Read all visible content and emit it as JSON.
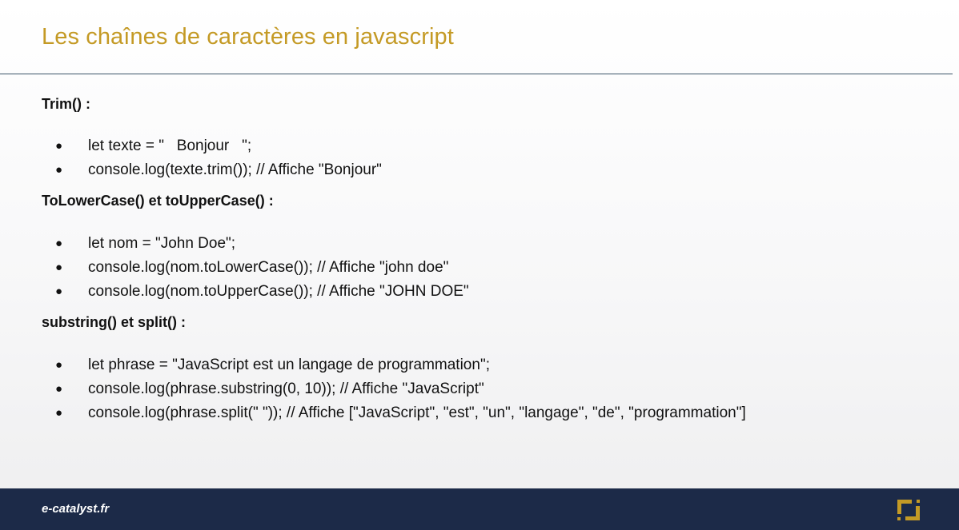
{
  "slide": {
    "title": "Les chaînes de caractères en javascript"
  },
  "sections": [
    {
      "heading": "Trim() :",
      "items": [
        "let texte = \"   Bonjour   \";",
        "console.log(texte.trim()); // Affiche \"Bonjour\""
      ]
    },
    {
      "heading": "ToLowerCase() et toUpperCase() :",
      "items": [
        "let nom = \"John Doe\";",
        "console.log(nom.toLowerCase()); // Affiche \"john doe\"",
        "console.log(nom.toUpperCase()); // Affiche \"JOHN DOE\""
      ]
    },
    {
      "heading": "substring() et split() :",
      "items": [
        "let phrase = \"JavaScript est un langage de programmation\";",
        "console.log(phrase.substring(0, 10)); // Affiche \"JavaScript\"",
        "console.log(phrase.split(\" \")); // Affiche [\"JavaScript\", \"est\", \"un\", \"langage\", \"de\", \"programmation\"]"
      ]
    }
  ],
  "footer": {
    "site": "e-catalyst.fr",
    "logo_icon": "e-catalyst-bracket-logo-icon"
  },
  "colors": {
    "title": "#c49a25",
    "footer_bg": "#1c2a48",
    "accent_logo": "#c49a25",
    "divider": "#3b5468"
  }
}
